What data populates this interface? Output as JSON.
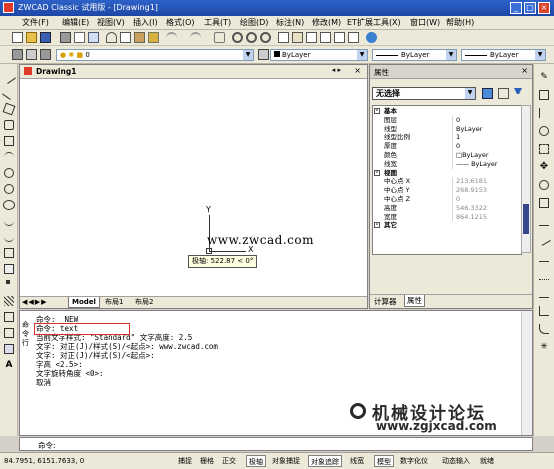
{
  "window": {
    "title": "ZWCAD Classic 试用版 - [Drawing1]",
    "controls": [
      "_",
      "□",
      "×"
    ]
  },
  "menu": [
    "文件(F)",
    "编辑(E)",
    "视图(V)",
    "插入(I)",
    "格式(O)",
    "工具(T)",
    "绘图(D)",
    "标注(N)",
    "修改(M)",
    "ET扩展工具(X)",
    "窗口(W)",
    "帮助(H)"
  ],
  "toolbar2": {
    "layer_value": "0",
    "color_value": "ByLayer",
    "linetype_value": "ByLayer",
    "lineweight_value": "ByLayer"
  },
  "drawing": {
    "tab_title": "Drawing1",
    "axis_x": "X",
    "axis_y": "Y",
    "watermark": "www.zwcad.com",
    "tooltip": "极轴: 522.87 < 0°",
    "layout_tabs": [
      "Model",
      "布局1",
      "布局2"
    ]
  },
  "properties": {
    "title": "属性",
    "selector": "无选择",
    "tabs": [
      "计算器",
      "属性"
    ],
    "rows": [
      {
        "type": "cat",
        "key": "基本"
      },
      {
        "type": "row",
        "key": "图层",
        "value": "0"
      },
      {
        "type": "row",
        "key": "线型",
        "value": "ByLayer"
      },
      {
        "type": "row",
        "key": "线型比例",
        "value": "1"
      },
      {
        "type": "row",
        "key": "厚度",
        "value": "0"
      },
      {
        "type": "row",
        "key": "颜色",
        "value": "□ByLayer"
      },
      {
        "type": "row",
        "key": "线宽",
        "value": "—— ByLayer"
      },
      {
        "type": "cat",
        "key": "视图"
      },
      {
        "type": "row",
        "key": "中心点 X",
        "value": "213.6181",
        "dim": true
      },
      {
        "type": "row",
        "key": "中心点 Y",
        "value": "268.9153",
        "dim": true
      },
      {
        "type": "row",
        "key": "中心点 Z",
        "value": "0",
        "dim": true
      },
      {
        "type": "row",
        "key": "高度",
        "value": "546.3322",
        "dim": true
      },
      {
        "type": "row",
        "key": "宽度",
        "value": "864.1215",
        "dim": true
      },
      {
        "type": "cat",
        "key": "其它"
      }
    ]
  },
  "command": {
    "side_label": "命令行",
    "lines": [
      "命令: _NEW",
      "命令: text",
      "当前文字样式: \"Standard\" 文字高度: 2.5",
      "文字: 对正(J)/样式(S)/<起点>: www.zwcad.com",
      "文字: 对正(J)/样式(S)/<起点>:",
      "字高 <2.5>:",
      "文字旋转角度 <0>:",
      "取消"
    ],
    "highlight_index": 1,
    "prompt": "命令:"
  },
  "site_watermark": {
    "title": "机械设计论坛",
    "url": "www.zgjxcad.com"
  },
  "status": {
    "coords": "84.7951, 6151.7633, 0",
    "buttons": [
      {
        "label": "捕捉",
        "on": false
      },
      {
        "label": "栅格",
        "on": false
      },
      {
        "label": "正交",
        "on": false
      },
      {
        "label": "极轴",
        "on": true
      },
      {
        "label": "对象捕捉",
        "on": false
      },
      {
        "label": "对象追踪",
        "on": true
      },
      {
        "label": "线宽",
        "on": false
      },
      {
        "label": "模型",
        "on": true
      },
      {
        "label": "数字化仪",
        "on": false
      },
      {
        "label": "动态输入",
        "on": false
      },
      {
        "label": "就绪",
        "on": false
      }
    ]
  },
  "colors": {
    "title_bar": "#1d46a6",
    "highlight_box": "#d9302c",
    "tooltip_bg": "#ffffe1"
  }
}
